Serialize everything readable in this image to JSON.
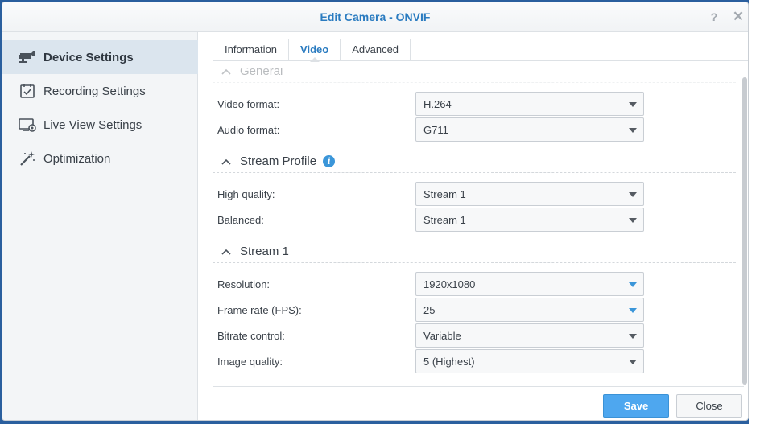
{
  "window": {
    "title": "Edit Camera - ONVIF",
    "help_glyph": "?",
    "close_glyph": "✕"
  },
  "sidebar": {
    "items": [
      {
        "label": "Device Settings",
        "icon": "camera-icon",
        "active": true
      },
      {
        "label": "Recording Settings",
        "icon": "calendar-check-icon",
        "active": false
      },
      {
        "label": "Live View Settings",
        "icon": "monitor-icon",
        "active": false
      },
      {
        "label": "Optimization",
        "icon": "magic-wand-icon",
        "active": false
      }
    ]
  },
  "tabs": [
    {
      "label": "Information",
      "active": false
    },
    {
      "label": "Video",
      "active": true
    },
    {
      "label": "Advanced",
      "active": false
    }
  ],
  "sections": {
    "general": {
      "title": "General",
      "fields": [
        {
          "label": "Video format:",
          "value": "H.264"
        },
        {
          "label": "Audio format:",
          "value": "G711"
        }
      ]
    },
    "stream_profile": {
      "title": "Stream Profile",
      "info_glyph": "i",
      "fields": [
        {
          "label": "High quality:",
          "value": "Stream 1"
        },
        {
          "label": "Balanced:",
          "value": "Stream 1"
        }
      ]
    },
    "stream1": {
      "title": "Stream 1",
      "fields": [
        {
          "label": "Resolution:",
          "value": "1920x1080"
        },
        {
          "label": "Frame rate (FPS):",
          "value": "25"
        },
        {
          "label": "Bitrate control:",
          "value": "Variable"
        },
        {
          "label": "Image quality:",
          "value": "5 (Highest)"
        }
      ]
    }
  },
  "footer": {
    "save_label": "Save",
    "close_label": "Close"
  },
  "colors": {
    "accent": "#2a7bc0",
    "save_button": "#4ea7ef",
    "info_icon": "#3b96d9"
  }
}
